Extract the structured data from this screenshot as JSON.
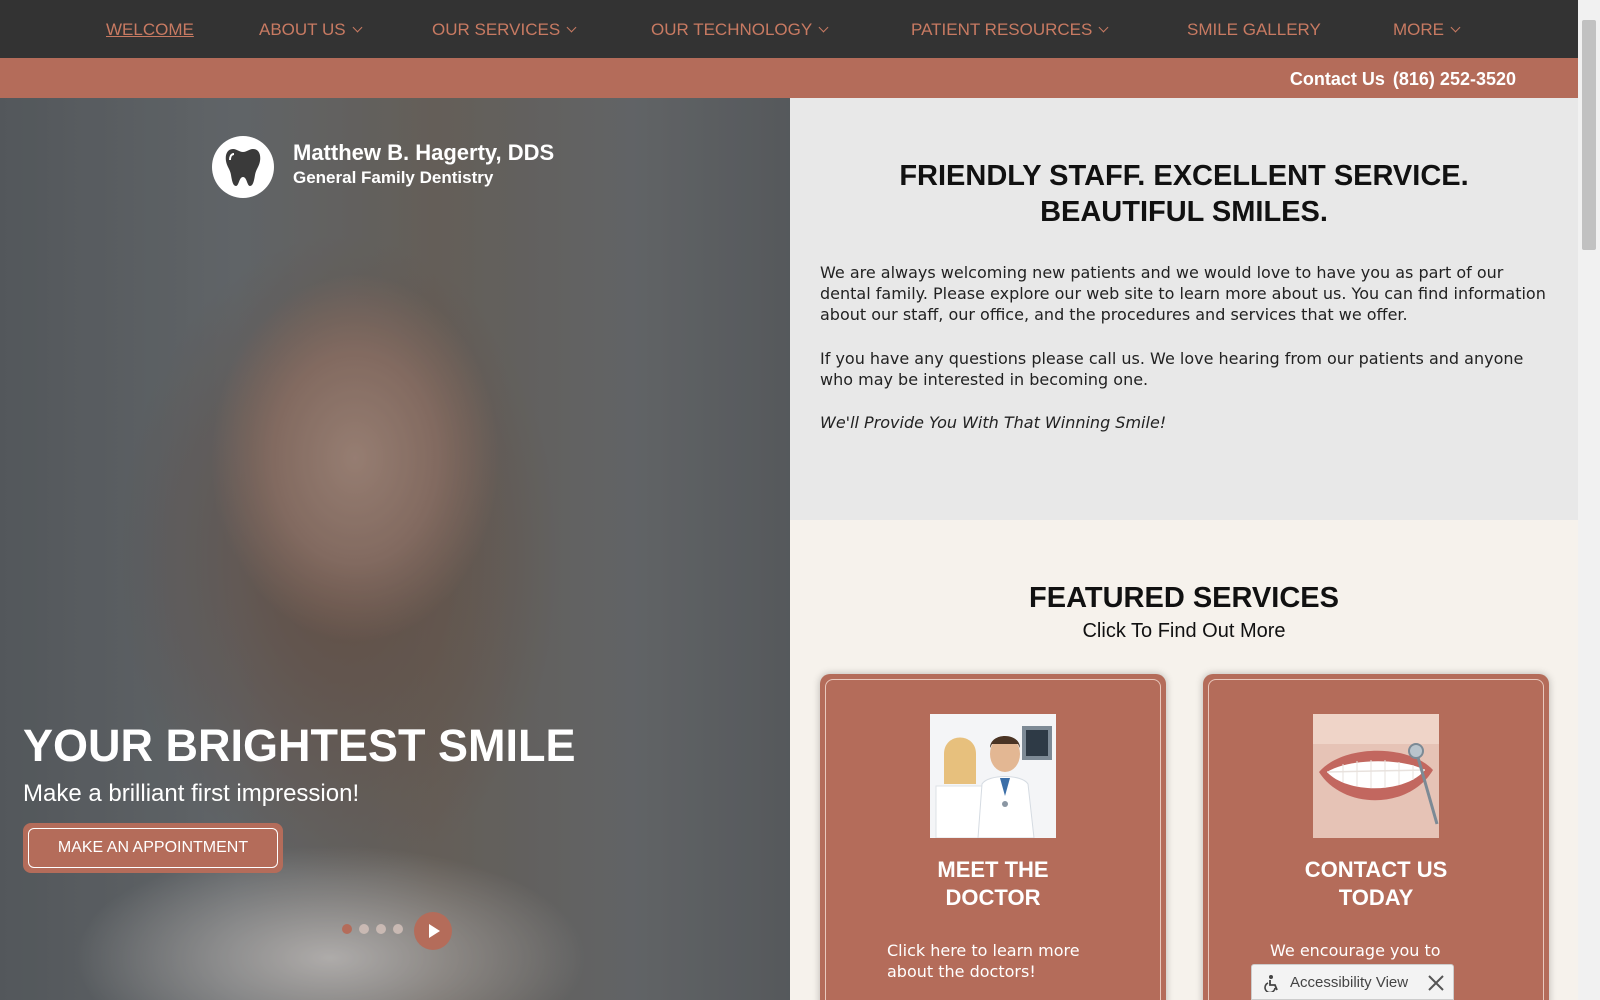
{
  "nav": {
    "items": [
      {
        "label": "WELCOME",
        "active": true,
        "dropdown": false
      },
      {
        "label": "ABOUT US",
        "active": false,
        "dropdown": true
      },
      {
        "label": "OUR SERVICES",
        "active": false,
        "dropdown": true
      },
      {
        "label": "OUR TECHNOLOGY",
        "active": false,
        "dropdown": true
      },
      {
        "label": "PATIENT RESOURCES",
        "active": false,
        "dropdown": true
      },
      {
        "label": "SMILE GALLERY",
        "active": false,
        "dropdown": false
      },
      {
        "label": "MORE",
        "active": false,
        "dropdown": true
      }
    ]
  },
  "contact": {
    "label": "Contact Us",
    "phone": "(816) 252-3520"
  },
  "logo": {
    "name": "Matthew B. Hagerty, DDS",
    "subtitle": "General Family Dentistry",
    "icon": "tooth-icon"
  },
  "hero": {
    "title": "YOUR BRIGHTEST SMILE",
    "subtitle": "Make a brilliant first impression!",
    "button": "MAKE AN APPOINTMENT",
    "slide_count": 4,
    "current_slide": 1,
    "play_icon": "play-icon"
  },
  "welcome": {
    "heading_line1": "FRIENDLY STAFF. EXCELLENT SERVICE.",
    "heading_line2": "BEAUTIFUL SMILES.",
    "para1": "We are always welcoming new patients and we would love to have you as part of our dental family. Please explore our web site to learn more about us. You can find information about our staff, our office, and the procedures and services that we offer.",
    "para2": "If you have any questions please call us. We love hearing from our patients and anyone who may be interested in becoming one.",
    "tagline": "We'll Provide You With That Winning Smile!"
  },
  "featured": {
    "heading": "FEATURED SERVICES",
    "subheading": "Click To Find Out More",
    "cards": [
      {
        "title_line1": "MEET THE",
        "title_line2": "DOCTOR",
        "desc": "Click here to learn more about the doctors!"
      },
      {
        "title_line1": "CONTACT US",
        "title_line2": "TODAY",
        "desc": "We encourage you to contact us!"
      }
    ]
  },
  "accessibility": {
    "label": "Accessibility View"
  },
  "colors": {
    "nav_bg": "#333333",
    "accent": "#b46c5a",
    "nav_text": "#c87a62",
    "panel_bg": "#e8e8e8",
    "featured_bg": "#f6f2ec"
  }
}
